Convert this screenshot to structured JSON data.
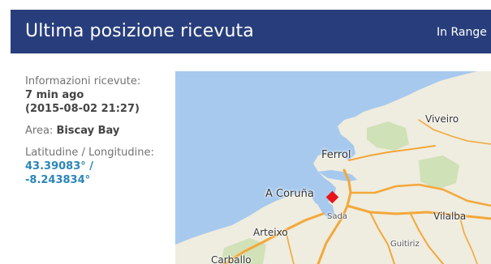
{
  "header": {
    "title": "Ultima posizione ricevuta",
    "status": "In Range"
  },
  "info": {
    "received_label": "Informazioni ricevute:",
    "received_ago": "7 min ago",
    "received_time": "(2015-08-02 21:27)",
    "area_label": "Area:",
    "area_value": "Biscay Bay",
    "latlon_label": "Latitudine / Longitudine:",
    "latitude": "43.39083° /",
    "longitude": "-8.243834°"
  },
  "map": {
    "places": {
      "viveiro": "Viveiro",
      "ferrol": "Ferrol",
      "a_coruna": "A Coruña",
      "sada": "Sada",
      "vilalba": "Vilalba",
      "arteixo": "Arteixo",
      "guitiriz": "Guitiriz",
      "carballo": "Carballo"
    },
    "colors": {
      "water": "#a7c9ee",
      "land": "#efece0",
      "road": "#f3a83a",
      "marker": "#e8141c"
    },
    "marker_icon": "position-marker-icon"
  }
}
